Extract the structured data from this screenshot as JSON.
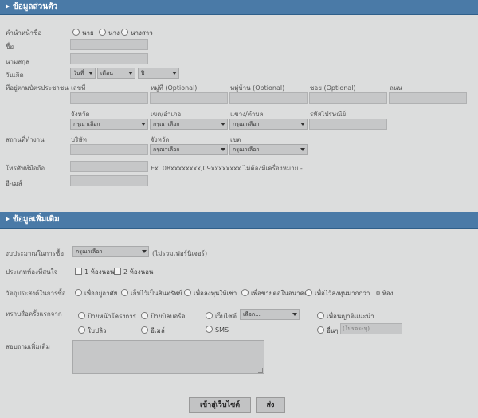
{
  "section1": {
    "title": "ข้อมูลส่วนตัว"
  },
  "prefix": {
    "label": "คำนำหน้าชื่อ",
    "options": [
      "นาย",
      "นาง",
      "นางสาว"
    ]
  },
  "first_name": {
    "label": "ชื่อ"
  },
  "last_name": {
    "label": "นามสกุล"
  },
  "birthdate": {
    "label": "วันเกิด",
    "day": "วันที่",
    "month": "เดือน",
    "year": "ปี"
  },
  "id_address": {
    "label": "ที่อยู่ตามบัตรประชาชน",
    "house_no": "เลขที่",
    "moo": "หมู่ที่ (Optional)",
    "village": "หมู่บ้าน (Optional)",
    "soi": "ซอย (Optional)",
    "road": "ถนน",
    "province": "จังหวัด",
    "district": "เขต/อำเภอ",
    "subdistrict": "แขวง/ตำบล",
    "postcode": "รหัสไปรษณีย์",
    "select_placeholder": "กรุณาเลือก"
  },
  "workplace": {
    "label": "สถานที่ทำงาน",
    "company": "บริษัท",
    "province": "จังหวัด",
    "district": "เขต",
    "select_placeholder": "กรุณาเลือก"
  },
  "phone": {
    "label": "โทรศัพท์มือถือ",
    "hint": "Ex. 08xxxxxxxx,09xxxxxxxx ไม่ต้องมีเครื่องหมาย -"
  },
  "email": {
    "label": "อี-เมล์"
  },
  "section2": {
    "title": "ข้อมูลเพิ่มเติม"
  },
  "budget": {
    "label": "งบประมาณในการซื้อ",
    "value": "กรุณาเลือก",
    "note": "(ไม่รวมเฟอร์นิเจอร์)"
  },
  "room_type": {
    "label": "ประเภทห้องที่สนใจ",
    "options": [
      "1 ห้องนอน",
      "2 ห้องนอน"
    ]
  },
  "purpose": {
    "label": "วัตถุประสงค์ในการซื้อ",
    "options": [
      "เพื่ออยู่อาศัย",
      "เก็บไว้เป็นสินทรัพย์",
      "เพื่อลงทุนให้เช่า",
      "เพื่อขายต่อในอนาคต",
      "เพื่อไว้ลงทุนมากกว่า 10 ห้อง"
    ]
  },
  "source": {
    "label": "ทราบสื่อครั้งแรกจาก",
    "row1": [
      "ป้ายหน้าโครงการ",
      "ป้ายบิลบอร์ด",
      "เว็บไซต์",
      "เพื่อนญาติแนะนำ"
    ],
    "website_select": "เลือก...",
    "row2": [
      "ใบปลิว",
      "อีเมล์",
      "SMS",
      "อื่นๆ"
    ],
    "other_placeholder": "(โปรดระบุ)"
  },
  "comments": {
    "label": "สอบถามเพิ่มเติม"
  },
  "buttons": {
    "visit": "เข้าสู่เว็บไซต์",
    "submit": "ส่ง"
  }
}
